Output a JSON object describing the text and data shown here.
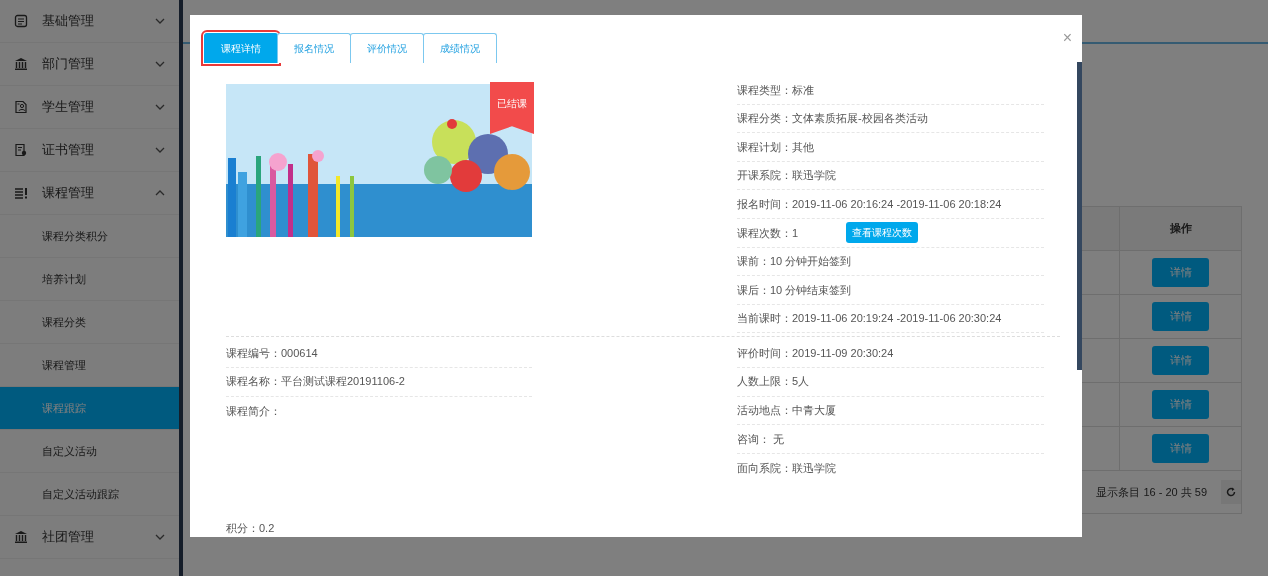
{
  "sidebar": {
    "items": [
      {
        "label": "基础管理",
        "expanded": false
      },
      {
        "label": "部门管理",
        "expanded": false
      },
      {
        "label": "学生管理",
        "expanded": false
      },
      {
        "label": "证书管理",
        "expanded": false
      },
      {
        "label": "课程管理",
        "expanded": true,
        "children": [
          {
            "label": "课程分类积分",
            "selected": false
          },
          {
            "label": "培养计划",
            "selected": false
          },
          {
            "label": "课程分类",
            "selected": false
          },
          {
            "label": "课程管理",
            "selected": false
          },
          {
            "label": "课程跟踪",
            "selected": true
          },
          {
            "label": "自定义活动",
            "selected": false
          },
          {
            "label": "自定义活动跟踪",
            "selected": false
          }
        ]
      },
      {
        "label": "社团管理",
        "expanded": false
      }
    ]
  },
  "table": {
    "columns": [
      "操作"
    ],
    "rows": [
      {
        "action": "详情"
      },
      {
        "action": "详情"
      },
      {
        "action": "详情"
      },
      {
        "action": "详情"
      },
      {
        "action": "详情"
      }
    ],
    "footer": "显示条目 16 - 20 共 59"
  },
  "modal": {
    "close": "×",
    "tabs": [
      {
        "label": "课程详情",
        "selected": true,
        "highlighted": true
      },
      {
        "label": "报名情况",
        "selected": false,
        "highlighted": false
      },
      {
        "label": "评价情况",
        "selected": false,
        "highlighted": false
      },
      {
        "label": "成绩情况",
        "selected": false,
        "highlighted": false
      }
    ],
    "cover": {
      "ribbon": "已结课"
    },
    "top_fields": [
      {
        "text": "课程类型：标准"
      },
      {
        "text": "课程分类：文体素质拓展-校园各类活动"
      },
      {
        "text": "课程计划：其他"
      },
      {
        "text": "开课系院：联迅学院"
      },
      {
        "text": "报名时间：2019-11-06 20:16:24 -2019-11-06 20:18:24"
      },
      {
        "text": "课程次数：1",
        "button": "查看课程次数"
      },
      {
        "text": "课前：10 分钟开始签到"
      },
      {
        "text": "课后：10 分钟结束签到"
      },
      {
        "text": "当前课时：2019-11-06 20:19:24 -2019-11-06 20:30:24"
      }
    ],
    "left_fields": [
      {
        "text": "课程编号：000614"
      },
      {
        "text": "课程名称：平台测试课程20191106-2"
      },
      {
        "text": "课程简介："
      }
    ],
    "right_fields": [
      {
        "text": "评价时间：2019-11-09 20:30:24"
      },
      {
        "text": "人数上限：5人"
      },
      {
        "text": "活动地点：中青大厦"
      },
      {
        "text": "咨询： 无"
      },
      {
        "text": "面向系院：联迅学院"
      }
    ],
    "score": "积分：0.2"
  }
}
